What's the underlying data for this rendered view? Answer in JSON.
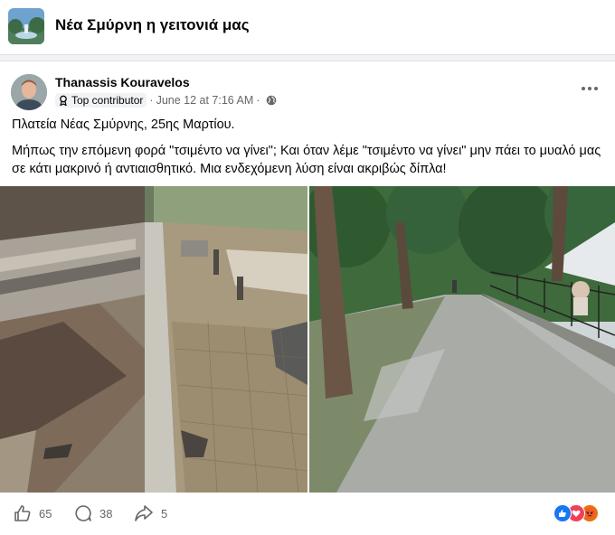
{
  "group": {
    "name": "Νέα Σμύρνη η γειτονιά μας"
  },
  "post": {
    "author": "Thanassis Kouravelos",
    "badge": "Top contributor",
    "timestamp": "June 12 at 7:16 AM",
    "meta_separator": "·",
    "text_line1": "Πλατεία Νέας Σμύρνης, 25ης Μαρτίου.",
    "text_body": "Μήπως την επόμενη φορά \"τσιμέντο να γίνει\"; Και όταν λέμε \"τσιμέντο να γίνει\" μην πάει το μυαλό μας σε κάτι μακρινό ή αντιαισθητικό. Μια ενδεχόμενη λύση είναι ακριβώς δίπλα!",
    "photos": [
      {
        "icon": "photo-damaged-tiled-pavement"
      },
      {
        "icon": "photo-concrete-tree-lined-path"
      }
    ]
  },
  "footer": {
    "likes": "65",
    "comments": "38",
    "shares": "5",
    "reactions": [
      "like-icon",
      "love-icon",
      "angry-icon"
    ]
  },
  "colors": {
    "page_bg": "#f0f2f5",
    "card_bg": "#ffffff",
    "text_primary": "#050505",
    "text_secondary": "#65676b",
    "like_blue": "#1877f2",
    "love_red": "#f33e58",
    "angry_orange": "#e9710f"
  }
}
